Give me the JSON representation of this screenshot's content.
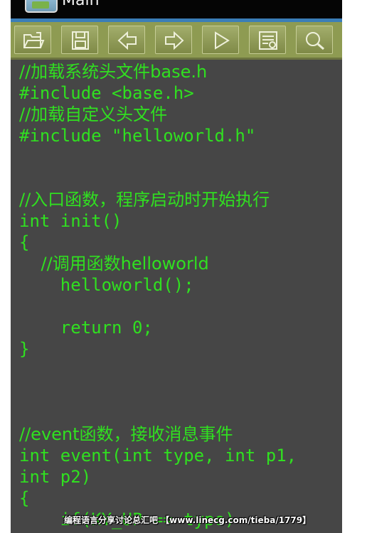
{
  "window": {
    "title": "Main"
  },
  "toolbar": {
    "buttons": [
      {
        "icon": "open-folder-icon"
      },
      {
        "icon": "save-disk-icon"
      },
      {
        "icon": "arrow-left-icon"
      },
      {
        "icon": "arrow-right-icon"
      },
      {
        "icon": "play-icon"
      },
      {
        "icon": "document-settings-icon"
      },
      {
        "icon": "search-icon"
      }
    ]
  },
  "editor": {
    "text_color": "#30e020",
    "background_color": "#464646",
    "lines": [
      "//加载系统头文件base.h",
      "#include <base.h>",
      "//加载自定义头文件",
      "#include \"helloworld.h\"",
      "",
      "",
      "//入口函数，程序启动时开始执行",
      "int init()",
      "{",
      "    //调用函数helloworld",
      "    helloworld();",
      "",
      "    return 0;",
      "}",
      "",
      "",
      "",
      "//event函数，接收消息事件",
      "int event(int type, int p1,",
      "int p2)",
      "{",
      "    if(KY_UP == type)"
    ]
  },
  "watermark": {
    "text": "编程语言分享讨论总汇吧 【www.linecg.com/tieba/1779】"
  },
  "colors": {
    "toolbar": "#8e9b52",
    "accent": "#3a7eb8",
    "titlebar": "#050505"
  }
}
